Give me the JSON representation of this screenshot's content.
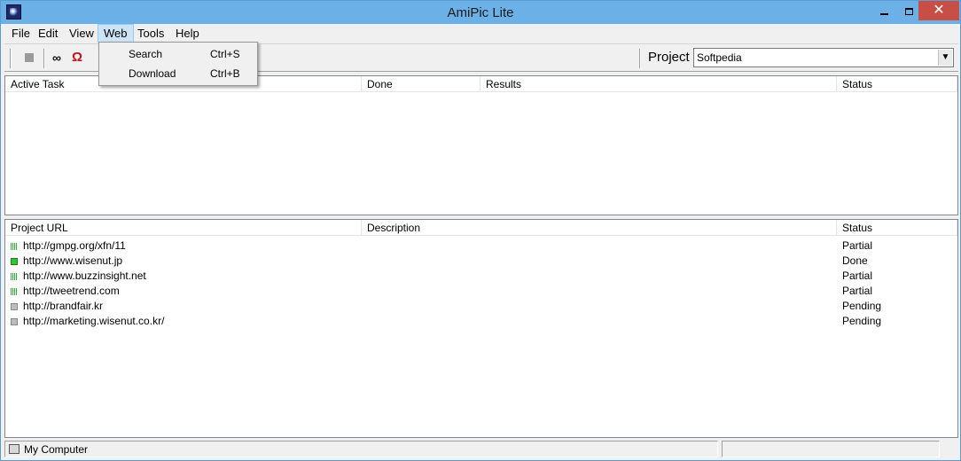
{
  "window": {
    "title": "AmiPic Lite"
  },
  "menu": [
    {
      "label": "File"
    },
    {
      "label": "Edit"
    },
    {
      "label": "View"
    },
    {
      "label": "Web"
    },
    {
      "label": "Tools"
    },
    {
      "label": "Help"
    }
  ],
  "web_menu": {
    "items": [
      {
        "label": "Search",
        "shortcut": "Ctrl+S"
      },
      {
        "label": "Download",
        "shortcut": "Ctrl+B"
      }
    ]
  },
  "toolbar": {
    "project_label": "Project",
    "project_value": "Softpedia",
    "icons": [
      "stop-icon",
      "binoculars-icon",
      "magnet-icon"
    ]
  },
  "tasks": {
    "columns": [
      "Active Task",
      "Done",
      "Results",
      "Status"
    ],
    "rows": []
  },
  "projects": {
    "columns": [
      "Project URL",
      "Description",
      "Status"
    ],
    "rows": [
      {
        "url": "http://gmpg.org/xfn/11",
        "description": "",
        "status": "Partial",
        "icon": "partial"
      },
      {
        "url": "http://www.wisenut.jp",
        "description": "",
        "status": "Done",
        "icon": "done"
      },
      {
        "url": "http://www.buzzinsight.net",
        "description": "",
        "status": "Partial",
        "icon": "partial"
      },
      {
        "url": "http://tweetrend.com",
        "description": "",
        "status": "Partial",
        "icon": "partial"
      },
      {
        "url": "http://brandfair.kr",
        "description": "",
        "status": "Pending",
        "icon": "pending"
      },
      {
        "url": "http://marketing.wisenut.co.kr/",
        "description": "",
        "status": "Pending",
        "icon": "pending"
      }
    ]
  },
  "statusbar": {
    "location": "My Computer"
  }
}
